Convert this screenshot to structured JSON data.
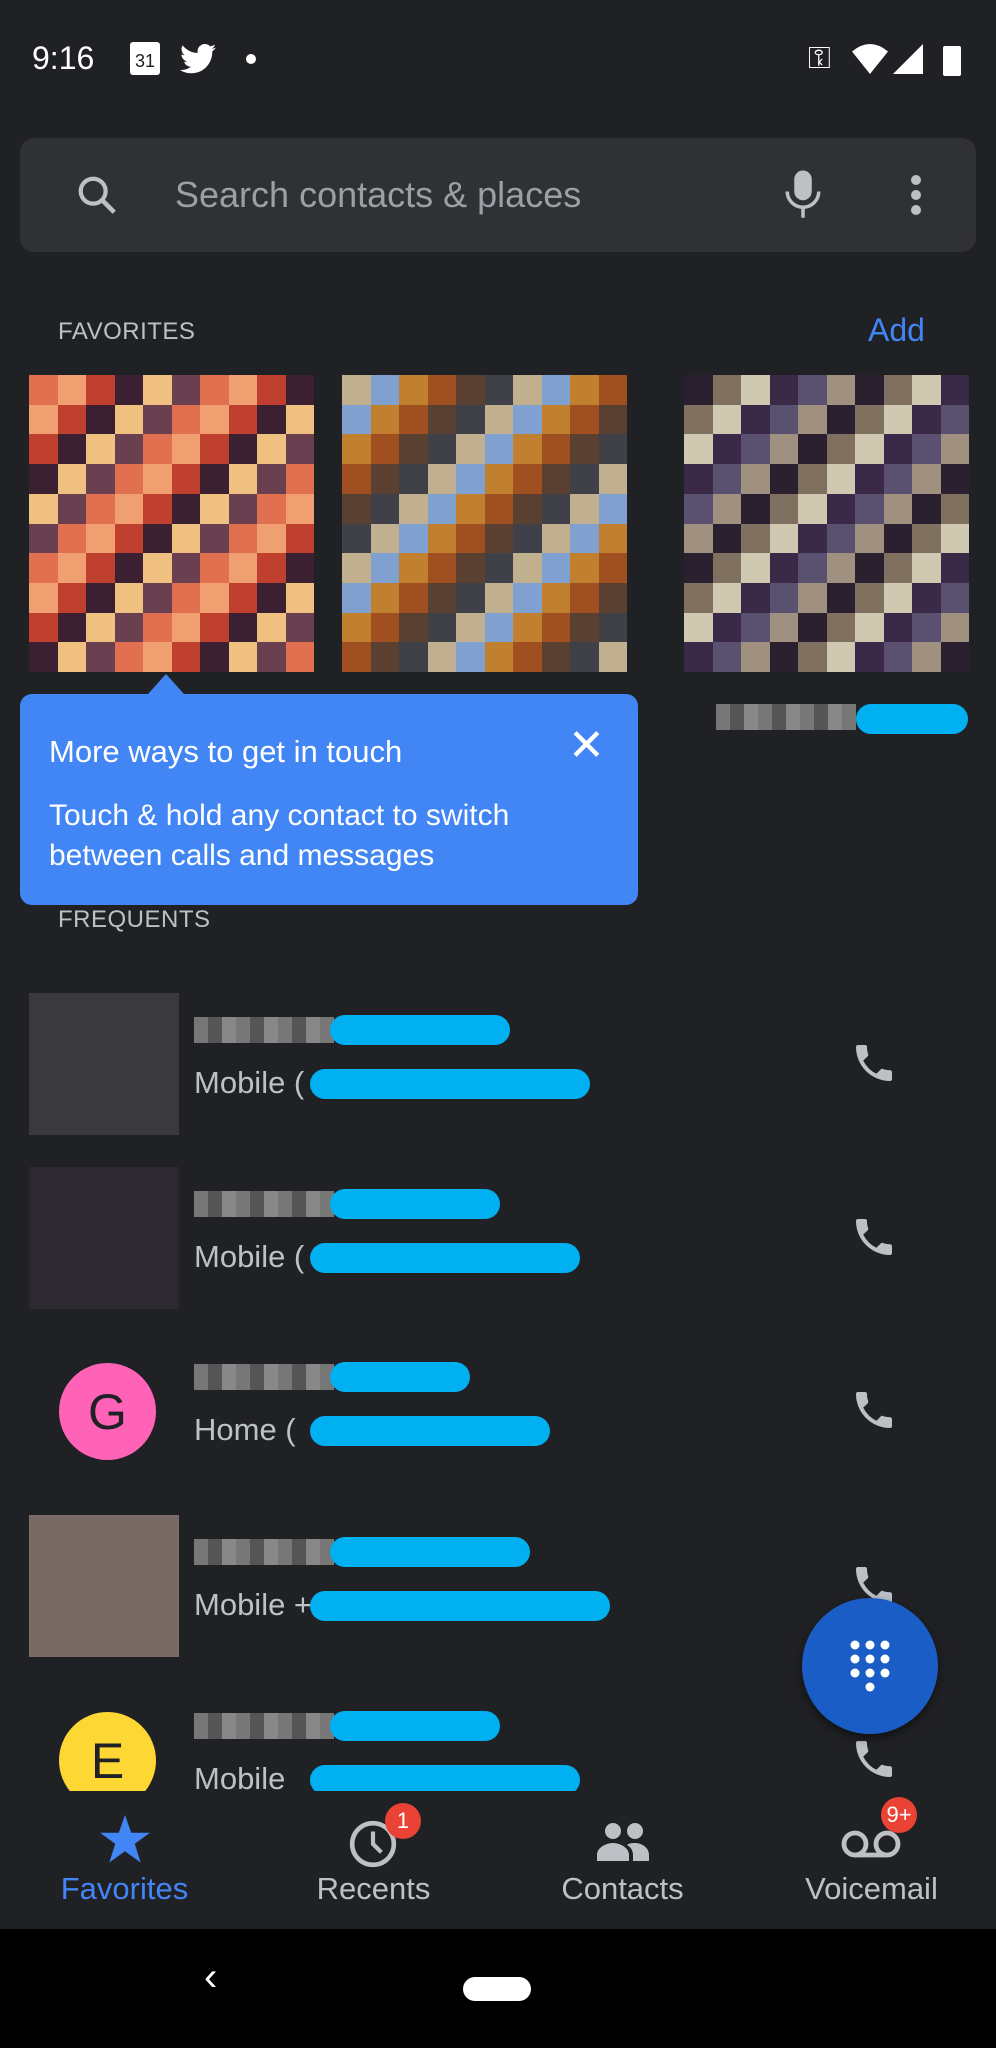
{
  "status_bar": {
    "time": "9:16",
    "calendar_day": "31",
    "icons": [
      "calendar-icon",
      "twitter-icon",
      "dot-icon",
      "vpn-key-icon",
      "wifi-icon",
      "signal-icon",
      "battery-charging-icon"
    ]
  },
  "search": {
    "placeholder": "Search contacts & places",
    "icons": [
      "search-icon",
      "mic-icon",
      "more-vert-icon"
    ]
  },
  "favorites": {
    "header": "FAVORITES",
    "add_label": "Add",
    "count": 3
  },
  "tooltip": {
    "title": "More ways to get in touch",
    "body": "Touch & hold any contact to switch between calls and messages"
  },
  "frequents": {
    "header": "FREQUENTS",
    "items": [
      {
        "avatar_type": "photo",
        "detail": "Mobile ("
      },
      {
        "avatar_type": "photo",
        "detail": "Mobile ("
      },
      {
        "avatar_type": "letter",
        "letter": "G",
        "color": "#ff63b8",
        "detail": "Home ("
      },
      {
        "avatar_type": "photo",
        "detail": "Mobile +"
      },
      {
        "avatar_type": "letter",
        "letter": "E",
        "color": "#fdd835",
        "detail": "Mobile"
      }
    ]
  },
  "bottom_nav": {
    "tabs": [
      {
        "label": "Favorites",
        "active": true
      },
      {
        "label": "Recents",
        "badge": "1"
      },
      {
        "label": "Contacts"
      },
      {
        "label": "Voicemail",
        "badge": "9+"
      }
    ]
  },
  "colors": {
    "accent": "#4285f4",
    "fab": "#1a5dc6",
    "badge": "#ea4335",
    "background": "#202124"
  }
}
